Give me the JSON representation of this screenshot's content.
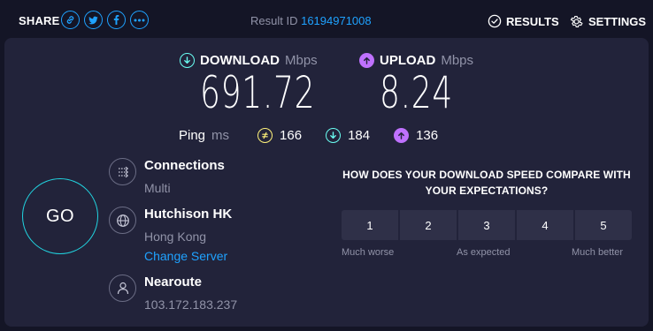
{
  "header": {
    "share_label": "SHARE",
    "share_icons": [
      "link-icon",
      "twitter-icon",
      "facebook-icon",
      "more-icon"
    ],
    "result_id_label": "Result ID",
    "result_id": "16194971008",
    "results_label": "RESULTS",
    "settings_label": "SETTINGS"
  },
  "download": {
    "label": "DOWNLOAD",
    "unit": "Mbps",
    "value": "691.72"
  },
  "upload": {
    "label": "UPLOAD",
    "unit": "Mbps",
    "value": "8.24"
  },
  "ping": {
    "label": "Ping",
    "unit": "ms",
    "idle": "166",
    "download": "184",
    "upload": "136"
  },
  "go_label": "GO",
  "connections": {
    "title": "Connections",
    "value": "Multi"
  },
  "server": {
    "title": "Hutchison HK",
    "location": "Hong Kong",
    "change_link": "Change Server"
  },
  "host": {
    "title": "Nearoute",
    "ip": "103.172.183.237"
  },
  "survey": {
    "question": "HOW DOES YOUR DOWNLOAD SPEED COMPARE WITH YOUR EXPECTATIONS?",
    "options": [
      "1",
      "2",
      "3",
      "4",
      "5"
    ],
    "low_label": "Much worse",
    "mid_label": "As expected",
    "high_label": "Much better"
  },
  "colors": {
    "background": "#141526",
    "panel": "#22233a",
    "accent_blue": "#1fa2ff",
    "download_teal": "#6afff3",
    "upload_purple": "#bf71ff",
    "idle_yellow": "#fff27a",
    "go_ring": "#21d4e0"
  }
}
